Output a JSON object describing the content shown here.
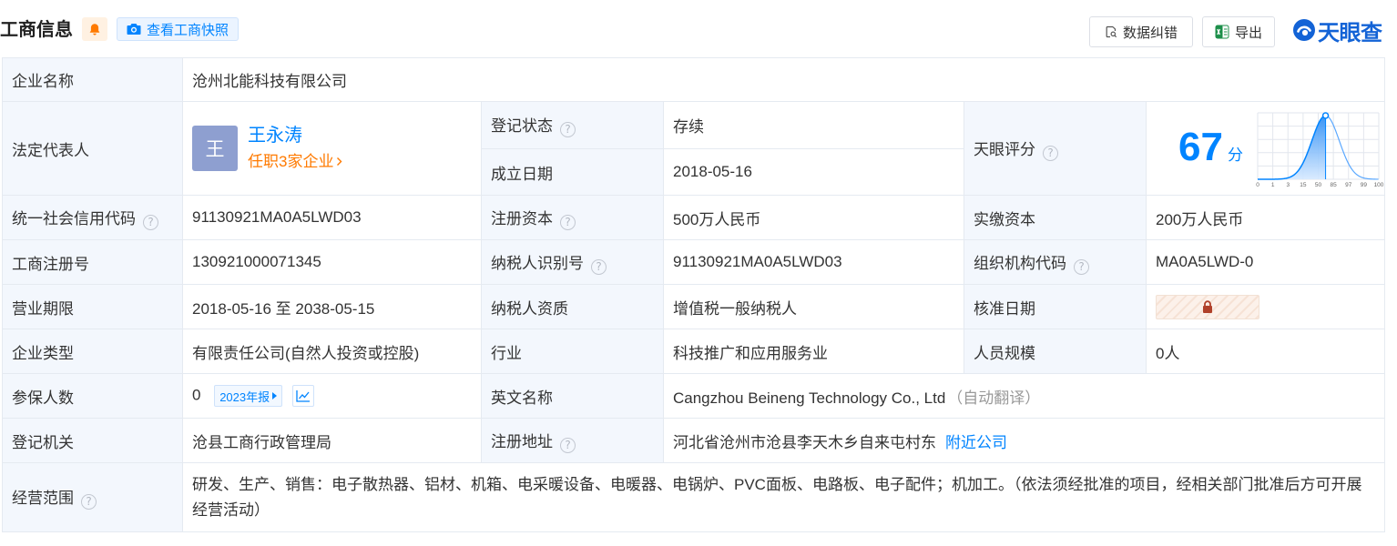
{
  "colors": {
    "accent": "#0084ff",
    "status_green": "#21a154",
    "link_orange": "#ff7a00",
    "avatar_bg": "#8e9fd0",
    "lock_brown": "#b0402a"
  },
  "icons": {
    "follow": "bell-icon",
    "snapshot": "camera-icon",
    "correction": "document-search-icon",
    "export": "excel-icon",
    "logo": "tianyancha-logo-icon",
    "help": "help-icon",
    "locked": "lock-icon",
    "trend": "line-chart-icon"
  },
  "header": {
    "title": "工商信息",
    "snapshot_label": "查看工商快照",
    "correction_label": "数据纠错",
    "export_label": "导出",
    "logo_text": "天眼查"
  },
  "info": {
    "company_name": {
      "label": "企业名称",
      "value": "沧州北能科技有限公司"
    },
    "legal_rep": {
      "label": "法定代表人",
      "avatar": "王",
      "name": "王永涛",
      "positions": "任职3家企业"
    },
    "reg_status": {
      "label": "登记状态",
      "value": "存续"
    },
    "founded": {
      "label": "成立日期",
      "value": "2018-05-16"
    },
    "score": {
      "label": "天眼评分",
      "value": 67,
      "unit": "分",
      "scale_labels": [
        "0",
        "1",
        "3",
        "15",
        "50",
        "85",
        "97",
        "99",
        "100"
      ]
    },
    "credit_code": {
      "label": "统一社会信用代码",
      "value": "91130921MA0A5LWD03"
    },
    "reg_capital": {
      "label": "注册资本",
      "value": "500万人民币"
    },
    "paid_capital": {
      "label": "实缴资本",
      "value": "200万人民币"
    },
    "reg_number": {
      "label": "工商注册号",
      "value": "130921000071345"
    },
    "taxpayer_id": {
      "label": "纳税人识别号",
      "value": "91130921MA0A5LWD03"
    },
    "org_code": {
      "label": "组织机构代码",
      "value": "MA0A5LWD-0"
    },
    "business_term": {
      "label": "营业期限",
      "value": "2018-05-16 至 2038-05-15"
    },
    "taxpayer_type": {
      "label": "纳税人资质",
      "value": "增值税一般纳税人"
    },
    "approval_date": {
      "label": "核准日期",
      "locked": true
    },
    "company_type": {
      "label": "企业类型",
      "value": "有限责任公司(自然人投资或控股)"
    },
    "industry": {
      "label": "行业",
      "value": "科技推广和应用服务业"
    },
    "staff_size": {
      "label": "人员规模",
      "value": "0人"
    },
    "insured": {
      "label": "参保人数",
      "value": "0",
      "report_label": "2023年报"
    },
    "english_name": {
      "label": "英文名称",
      "value": "Cangzhou Beineng Technology Co., Ltd",
      "note": "（自动翻译）"
    },
    "reg_authority": {
      "label": "登记机关",
      "value": "沧县工商行政管理局"
    },
    "reg_address": {
      "label": "注册地址",
      "value": "河北省沧州市沧县李天木乡自来屯村东",
      "link": "附近公司"
    },
    "scope": {
      "label": "经营范围",
      "value": "研发、生产、销售：电子散热器、铝材、机箱、电采暖设备、电暖器、电锅炉、PVC面板、电路板、电子配件；机加工。（依法须经批准的项目，经相关部门批准后方可开展经营活动）"
    }
  }
}
